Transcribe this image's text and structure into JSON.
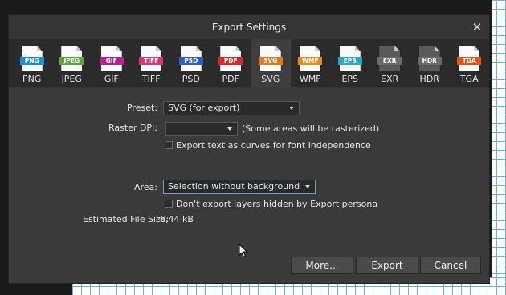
{
  "dialog": {
    "title": "Export Settings",
    "close_label": "✕"
  },
  "tabs": [
    {
      "label": "PNG",
      "badge": "PNG",
      "color": "#1e8fd6",
      "active": false
    },
    {
      "label": "JPEG",
      "badge": "JPEG",
      "color": "#58a83a",
      "active": false
    },
    {
      "label": "GIF",
      "badge": "GIF",
      "color": "#b2278e",
      "active": false
    },
    {
      "label": "TIFF",
      "badge": "TIFF",
      "color": "#d5367a",
      "active": false
    },
    {
      "label": "PSD",
      "badge": "PSD",
      "color": "#2d5fc4",
      "active": false
    },
    {
      "label": "PDF",
      "badge": "PDF",
      "color": "#d52a2a",
      "active": false
    },
    {
      "label": "SVG",
      "badge": "SVG",
      "color": "#e07a1f",
      "active": true
    },
    {
      "label": "WMF",
      "badge": "WMF",
      "color": "#e88a1c",
      "active": false
    },
    {
      "label": "EPS",
      "badge": "EPS",
      "color": "#2aa9c2",
      "active": false
    },
    {
      "label": "EXR",
      "badge": "EXR",
      "color": "#6a6a6a",
      "active": false
    },
    {
      "label": "HDR",
      "badge": "HDR",
      "color": "#6a6a6a",
      "active": false
    },
    {
      "label": "TGA",
      "badge": "TGA",
      "color": "#e2541d",
      "active": false
    }
  ],
  "preset": {
    "label": "Preset:",
    "value": "SVG (for export)"
  },
  "raster_dpi": {
    "label": "Raster DPI:",
    "value": "",
    "note": "(Some areas will be rasterized)"
  },
  "curves_checkbox": {
    "label": "Export text as curves for font independence",
    "checked": false
  },
  "area": {
    "label": "Area:",
    "value": "Selection without background"
  },
  "hidden_layers_checkbox": {
    "label": "Don't export layers hidden by Export persona",
    "checked": false
  },
  "file_size": {
    "label": "Estimated File Size:",
    "value": "6,44 kB"
  },
  "buttons": {
    "more": "More...",
    "export": "Export",
    "cancel": "Cancel"
  }
}
